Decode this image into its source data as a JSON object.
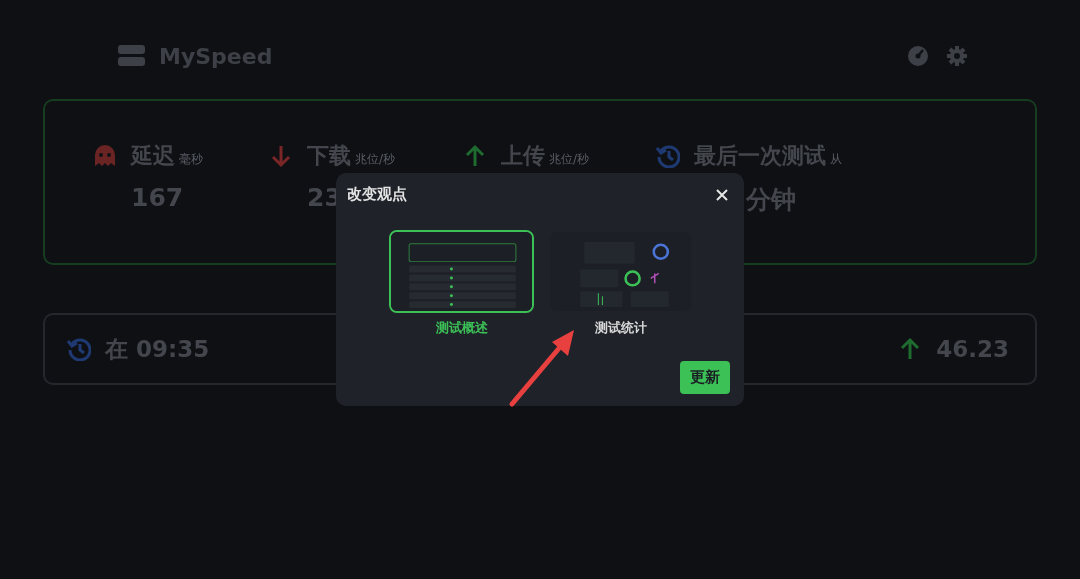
{
  "app": {
    "title": "MySpeed"
  },
  "summary": {
    "stats": [
      {
        "kind": "ping",
        "label": "延迟",
        "unit": "毫秒",
        "value": "167"
      },
      {
        "kind": "download",
        "label": "下载",
        "unit": "兆位/秒",
        "value": "23"
      },
      {
        "kind": "upload",
        "label": "上传",
        "unit": "兆位/秒"
      },
      {
        "kind": "last",
        "label": "最后一次测试",
        "unit": "从",
        "value": "分钟"
      }
    ]
  },
  "latest_test": {
    "time": "在 09:35",
    "upload": "46.23"
  },
  "dialog": {
    "title": "改变观点",
    "options": [
      {
        "label": "测试概述",
        "selected": true,
        "kind": "picture"
      },
      {
        "label": "测试统计",
        "selected": false,
        "kind": "picture"
      }
    ],
    "button": "更新"
  },
  "annotation": {
    "kind": "arrow"
  }
}
